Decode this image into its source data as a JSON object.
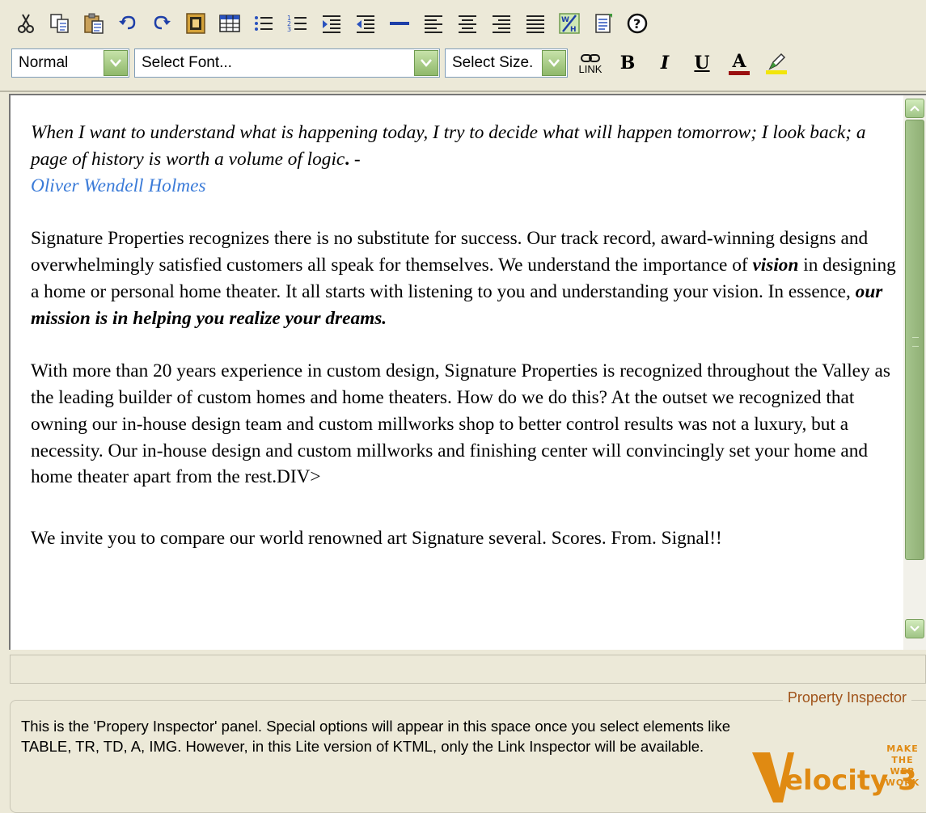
{
  "toolbar": {
    "row1_icons": [
      "cut-icon",
      "copy-icon",
      "paste-icon",
      "undo-icon",
      "redo-icon",
      "image-icon",
      "table-icon",
      "unordered-list-icon",
      "ordered-list-icon",
      "indent-icon",
      "outdent-icon",
      "horizontal-rule-icon",
      "align-left-icon",
      "align-center-icon",
      "align-right-icon",
      "justify-icon",
      "html-view-icon",
      "properties-icon",
      "help-icon"
    ],
    "style_select": "Normal",
    "font_select": "Select Font...",
    "size_select": "Select Size.",
    "link_label": "LINK",
    "bold_label": "B",
    "italic_label": "I",
    "underline_label": "U",
    "font_color_label": "A"
  },
  "editor": {
    "quote_part1": "When I want to understand what is happening today, I try to decide what will happen tomorrow; I look back; a page of history is worth a volume of logic",
    "quote_bold_dot": ".",
    "quote_dash": " -",
    "quote_author": "Oliver Wendell Holmes",
    "para1_a": "Signature Properties recognizes there is no substitute for success. Our track record, award-winning designs and overwhelmingly satisfied customers all speak for themselves. We understand the importance of ",
    "para1_vision": "vision",
    "para1_b": " in designing a home or personal home theater. It all starts with listening to you and understanding your vision. In essence, ",
    "para1_mission": "our mission is in helping you realize your dreams.",
    "para2": "With more than 20 years experience in custom design, Signature Properties is recognized throughout the Valley as the leading builder of custom homes and home theaters. How do we do this? At the outset we recognized that owning our in-house design team and custom millworks shop to better control results was not a luxury, but a necessity. Our in-house design and custom millworks and finishing center will convincingly set your home and home theater apart from the rest.DIV>",
    "para3_partial": "We invite you to compare our world renowned art Signature several. Scores. From. Signal!!"
  },
  "inspector": {
    "legend": "Property Inspector",
    "text": "This is the 'Propery Inspector' panel. Special options will appear in this space once you select elements like TABLE, TR, TD, A, IMG. However, in this Lite version of KTML, only the Link Inspector will be available.",
    "logo_word": "elocity 3",
    "logo_v": "V",
    "tagline": [
      "MAKE",
      "THE",
      "WEB",
      "WORK"
    ]
  },
  "colors": {
    "accent_green": "#8fb86a",
    "author_link": "#3b7bd8",
    "legend_text": "#a0531a",
    "logo_orange": "#e08a12"
  }
}
